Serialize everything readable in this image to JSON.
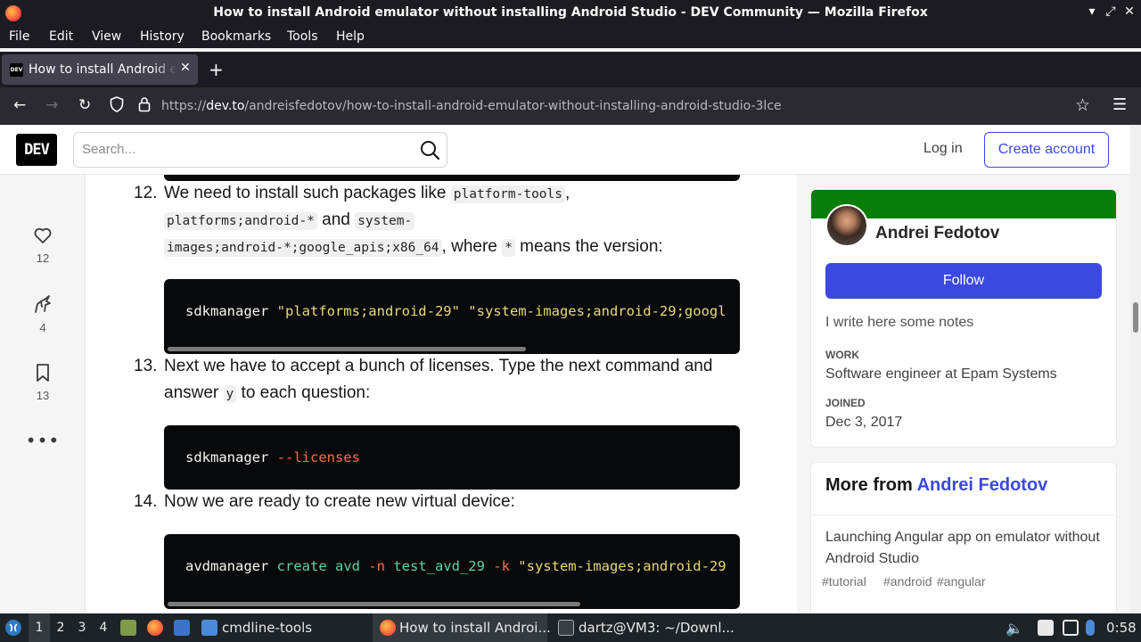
{
  "window": {
    "title": "How to install Android emulator without installing Android Studio - DEV Community — Mozilla Firefox",
    "controls": [
      "minimize-icon",
      "maximize-icon",
      "close-icon"
    ]
  },
  "menubar": [
    "File",
    "Edit",
    "View",
    "History",
    "Bookmarks",
    "Tools",
    "Help"
  ],
  "tab": {
    "title": "How to install Android emulator without installing Android Studio",
    "favicon": "DEV"
  },
  "url": {
    "scheme": "https://",
    "host": "dev.to",
    "path": "/andreisfedotov/how-to-install-android-emulator-without-installing-android-studio-3lce"
  },
  "site": {
    "logo": "DEV",
    "search_placeholder": "Search...",
    "login": "Log in",
    "create_account": "Create account"
  },
  "reactions": [
    {
      "icon": "heart-icon",
      "count": "12"
    },
    {
      "icon": "unicorn-icon",
      "count": "4"
    },
    {
      "icon": "bookmark-icon",
      "count": "13"
    }
  ],
  "article": {
    "step12": {
      "num": "12.",
      "t1": "We need to install such packages like ",
      "c1": "platform-tools",
      "t2": ",",
      "c2": "platforms;android-*",
      "t3": " and ",
      "c3": "system-",
      "c4": "images;android-*;google_apis;x86_64",
      "t4": ", where ",
      "c5": "*",
      "t5": " means the version:"
    },
    "code12": {
      "cmd": "sdkmanager ",
      "arg1": "\"platforms;android-29\"",
      "arg2": " \"system-images;android-29;googl"
    },
    "step13": {
      "num": "13.",
      "t1": "Next we have to accept a bunch of licenses. Type the next command and",
      "t2": "answer ",
      "c1": "y",
      "t3": " to each question:"
    },
    "code13": {
      "cmd": "sdkmanager ",
      "flag": "--licenses"
    },
    "step14": {
      "num": "14.",
      "t1": "Now we are ready to create new virtual device:"
    },
    "code14": {
      "cmd": "avdmanager ",
      "sub": "create avd ",
      "f1": "-n ",
      "name": "test_avd_29 ",
      "f2": "-k ",
      "arg": "\"system-images;android-29"
    }
  },
  "profile": {
    "name": "Andrei Fedotov",
    "follow": "Follow",
    "bio": "I write here some notes",
    "work_label": "WORK",
    "work": "Software engineer at Epam Systems",
    "joined_label": "JOINED",
    "joined": "Dec 3, 2017",
    "brand_color": "#087d08"
  },
  "more_from": {
    "prefix": "More from ",
    "author": "Andrei Fedotov",
    "post_title": "Launching Angular app on emulator without Android Studio",
    "tags": [
      "#tutorial",
      "#android",
      "#angular"
    ]
  },
  "taskbar": {
    "workspaces": [
      "1",
      "2",
      "3",
      "4"
    ],
    "items": [
      {
        "label": "cmdline-tools",
        "icon": "folder-icon"
      },
      {
        "label": "How to install Androi...",
        "icon": "firefox-icon"
      },
      {
        "label": "dartz@VM3: ~/Downl...",
        "icon": "terminal-icon"
      }
    ],
    "clock": "0:58"
  }
}
